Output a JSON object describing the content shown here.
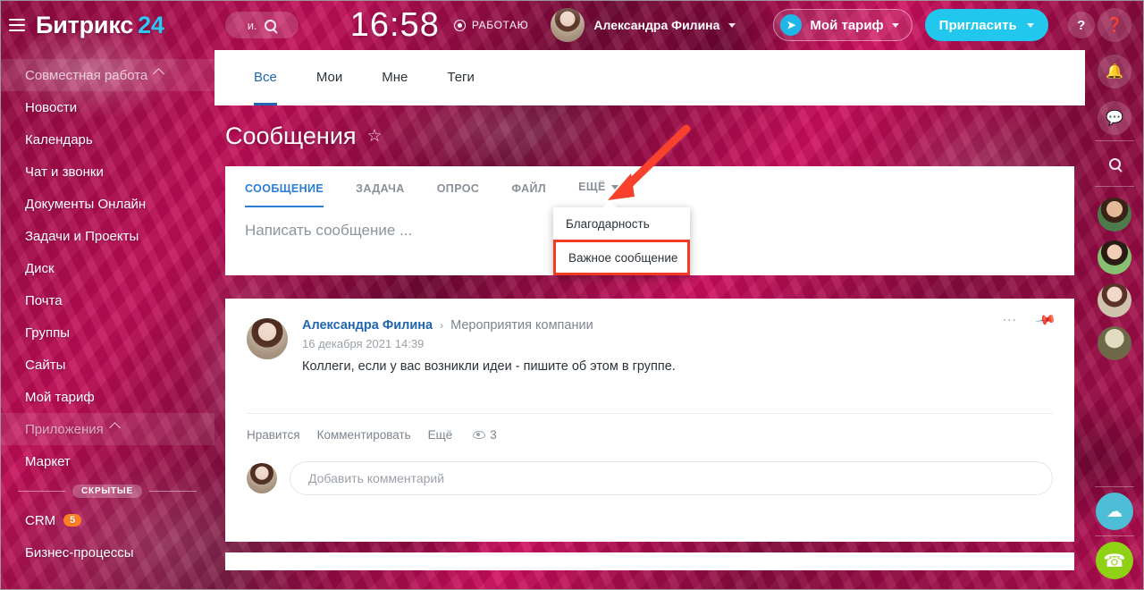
{
  "topbar": {
    "menu_icon": "hamburger-icon",
    "logo_text": "Битрикс",
    "logo_number": "24",
    "search_text": "и.",
    "search_icon": "search-icon",
    "clock": "16:58",
    "status_label": "РАБОТАЮ",
    "status_icon": "record-icon",
    "user_name": "Александра Филина",
    "tariff_label": "Мой тариф",
    "tariff_icon": "rocket-icon",
    "invite_label": "Пригласить",
    "help_label": "?"
  },
  "sidebar": {
    "section_title": "Совместная работа",
    "items": [
      {
        "label": "Новости"
      },
      {
        "label": "Календарь"
      },
      {
        "label": "Чат и звонки"
      },
      {
        "label": "Документы Онлайн"
      },
      {
        "label": "Задачи и Проекты"
      },
      {
        "label": "Диск"
      },
      {
        "label": "Почта"
      },
      {
        "label": "Группы"
      },
      {
        "label": "Сайты"
      },
      {
        "label": "Мой тариф"
      }
    ],
    "apps_section": "Приложения",
    "apps_items": [
      {
        "label": "Маркет"
      }
    ],
    "hidden_label": "СКРЫТЫЕ",
    "hidden_items": [
      {
        "label": "CRM",
        "badge": "5"
      },
      {
        "label": "Бизнес-процессы",
        "badge": ""
      }
    ]
  },
  "content": {
    "tabs": [
      {
        "label": "Все",
        "active": true
      },
      {
        "label": "Мои",
        "active": false
      },
      {
        "label": "Мне",
        "active": false
      },
      {
        "label": "Теги",
        "active": false
      }
    ],
    "page_title": "Сообщения",
    "favorite_icon": "star-icon"
  },
  "post_form": {
    "tabs": [
      {
        "label": "СООБЩЕНИЕ",
        "active": true
      },
      {
        "label": "ЗАДАЧА",
        "active": false
      },
      {
        "label": "ОПРОС",
        "active": false
      },
      {
        "label": "ФАЙЛ",
        "active": false
      },
      {
        "label": "ЕЩЁ",
        "active": false
      }
    ],
    "placeholder": "Написать сообщение ...",
    "dropdown": {
      "items": [
        {
          "label": "Благодарность",
          "highlighted": false
        },
        {
          "label": "Важное сообщение",
          "highlighted": true
        }
      ],
      "highlight_color": "#f23a25"
    }
  },
  "post": {
    "author": "Александра Филина",
    "separator": "›",
    "group": "Мероприятия компании",
    "date": "16 декабря 2021 14:39",
    "text": "Коллеги, если у вас возникли идеи - пишите об этом в группе.",
    "menu_icon": "more-dots-icon",
    "pin_icon": "pin-icon",
    "actions": [
      {
        "label": "Нравится"
      },
      {
        "label": "Комментировать"
      },
      {
        "label": "Ещё"
      }
    ],
    "views_count": "3",
    "views_icon": "eye-icon",
    "comment_placeholder": "Добавить комментарий"
  },
  "right_rail": {
    "icons": [
      {
        "name": "help-icon",
        "glyph": "?"
      },
      {
        "name": "bell-icon",
        "glyph": "🔔"
      },
      {
        "name": "chat-icon",
        "glyph": "💬"
      },
      {
        "name": "search-icon",
        "glyph": "🔍"
      }
    ],
    "mobile_app_icon": "mobile-cloud-icon",
    "call_icon": "phone-icon"
  },
  "colors": {
    "accent_blue": "#2067b0",
    "tab_blue": "#2a7fd4",
    "cyan": "#21c7ec",
    "magenta": "#a10e47",
    "badge_orange": "#ff7f26",
    "highlight_red": "#f23a25",
    "green": "#8fd115"
  }
}
